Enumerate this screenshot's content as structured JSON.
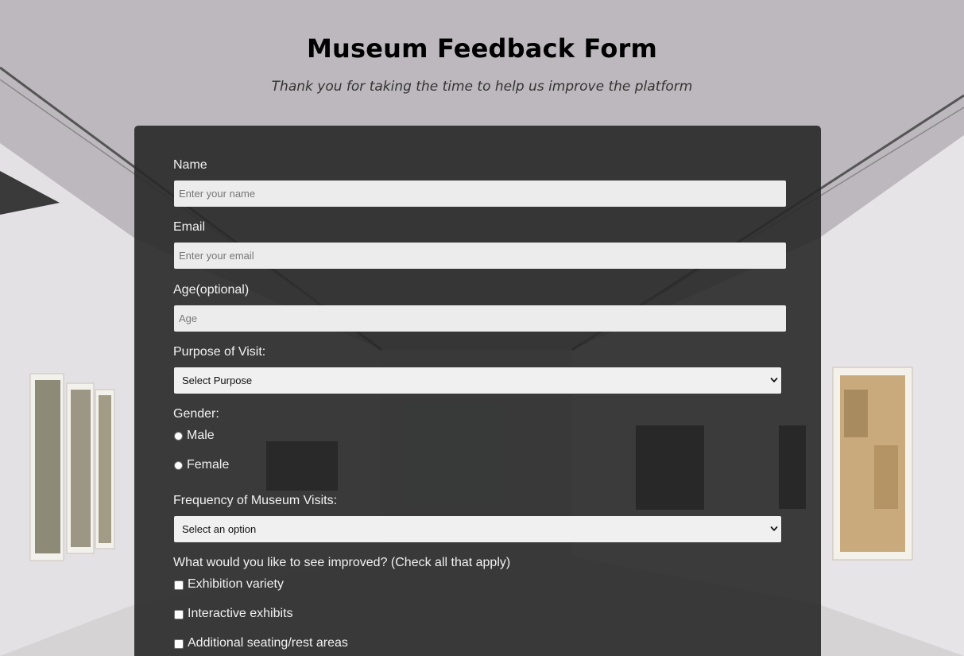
{
  "header": {
    "title": "Museum Feedback Form",
    "subtitle": "Thank you for taking the time to help us improve the platform"
  },
  "form": {
    "name": {
      "label": "Name",
      "placeholder": "Enter your name",
      "value": ""
    },
    "email": {
      "label": "Email",
      "placeholder": "Enter your email",
      "value": ""
    },
    "age": {
      "label": "Age(optional)",
      "placeholder": "Age",
      "value": ""
    },
    "purpose": {
      "label": "Purpose of Visit:",
      "selected": "Select Purpose"
    },
    "gender": {
      "label": "Gender:",
      "options": [
        "Male",
        "Female"
      ]
    },
    "frequency": {
      "label": "Frequency of Museum Visits:",
      "selected": "Select an option"
    },
    "improvements": {
      "label": "What would you like to see improved? (Check all that apply)",
      "options": [
        "Exhibition variety",
        "Interactive exhibits",
        "Additional seating/rest areas"
      ]
    }
  },
  "icons": {
    "select_arrow": "chevron-down-icon"
  }
}
